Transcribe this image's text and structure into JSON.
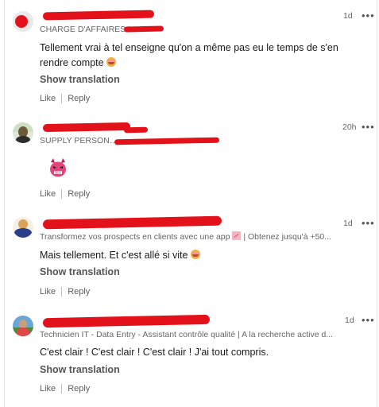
{
  "comments": [
    {
      "headline": "CHARGE D'AFFAIRES I",
      "time": "1d",
      "text": "Tellement vrai à tel enseigne qu'on a même pas eu le temps de s'en rendre compte",
      "emoji": "laughing-face-icon",
      "translation_label": "Show translation",
      "like_label": "Like",
      "reply_label": "Reply"
    },
    {
      "headline": "SUPPLY PERSON / S",
      "time": "20h",
      "emoji": "devil-face-icon",
      "like_label": "Like",
      "reply_label": "Reply"
    },
    {
      "headline": "Transformez vos prospects en clients avec une app",
      "headline_tail": "| Obtenez jusqu'à +50...",
      "time": "1d",
      "text": "Mais tellement. Et c'est allé si vite",
      "emoji": "laughing-face-icon",
      "translation_label": "Show translation",
      "like_label": "Like",
      "reply_label": "Reply"
    },
    {
      "headline": "Technicien IT - Data Entry - Assistant contrôle qualité | A la recherche active d...",
      "time": "1d",
      "text": "C'est clair ! C'est clair ! C'est clair ! J'ai tout compris.",
      "translation_label": "Show translation",
      "like_label": "Like",
      "reply_label": "Reply"
    }
  ],
  "more_label": "•••",
  "colors": {
    "redaction": "#e3121a",
    "muted_text": "#666666"
  }
}
